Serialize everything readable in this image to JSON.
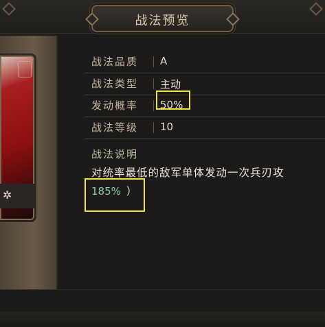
{
  "header": {
    "title": "战法预览"
  },
  "attributes": [
    {
      "label": "战法品质",
      "value": "A"
    },
    {
      "label": "战法类型",
      "value": "主动"
    },
    {
      "label": "发动概率",
      "value": "50%"
    },
    {
      "label": "战法等级",
      "value": "10"
    }
  ],
  "description": {
    "label": "战法说明",
    "text": "对统率最低的敌军单体发动一次兵刃攻",
    "value": "185%",
    "closing": "）"
  },
  "card": {
    "icon": "gear-icon"
  },
  "colors": {
    "highlight": "#f2e63a",
    "accent_value": "#8fcfb4",
    "label": "#c6b7a0"
  }
}
